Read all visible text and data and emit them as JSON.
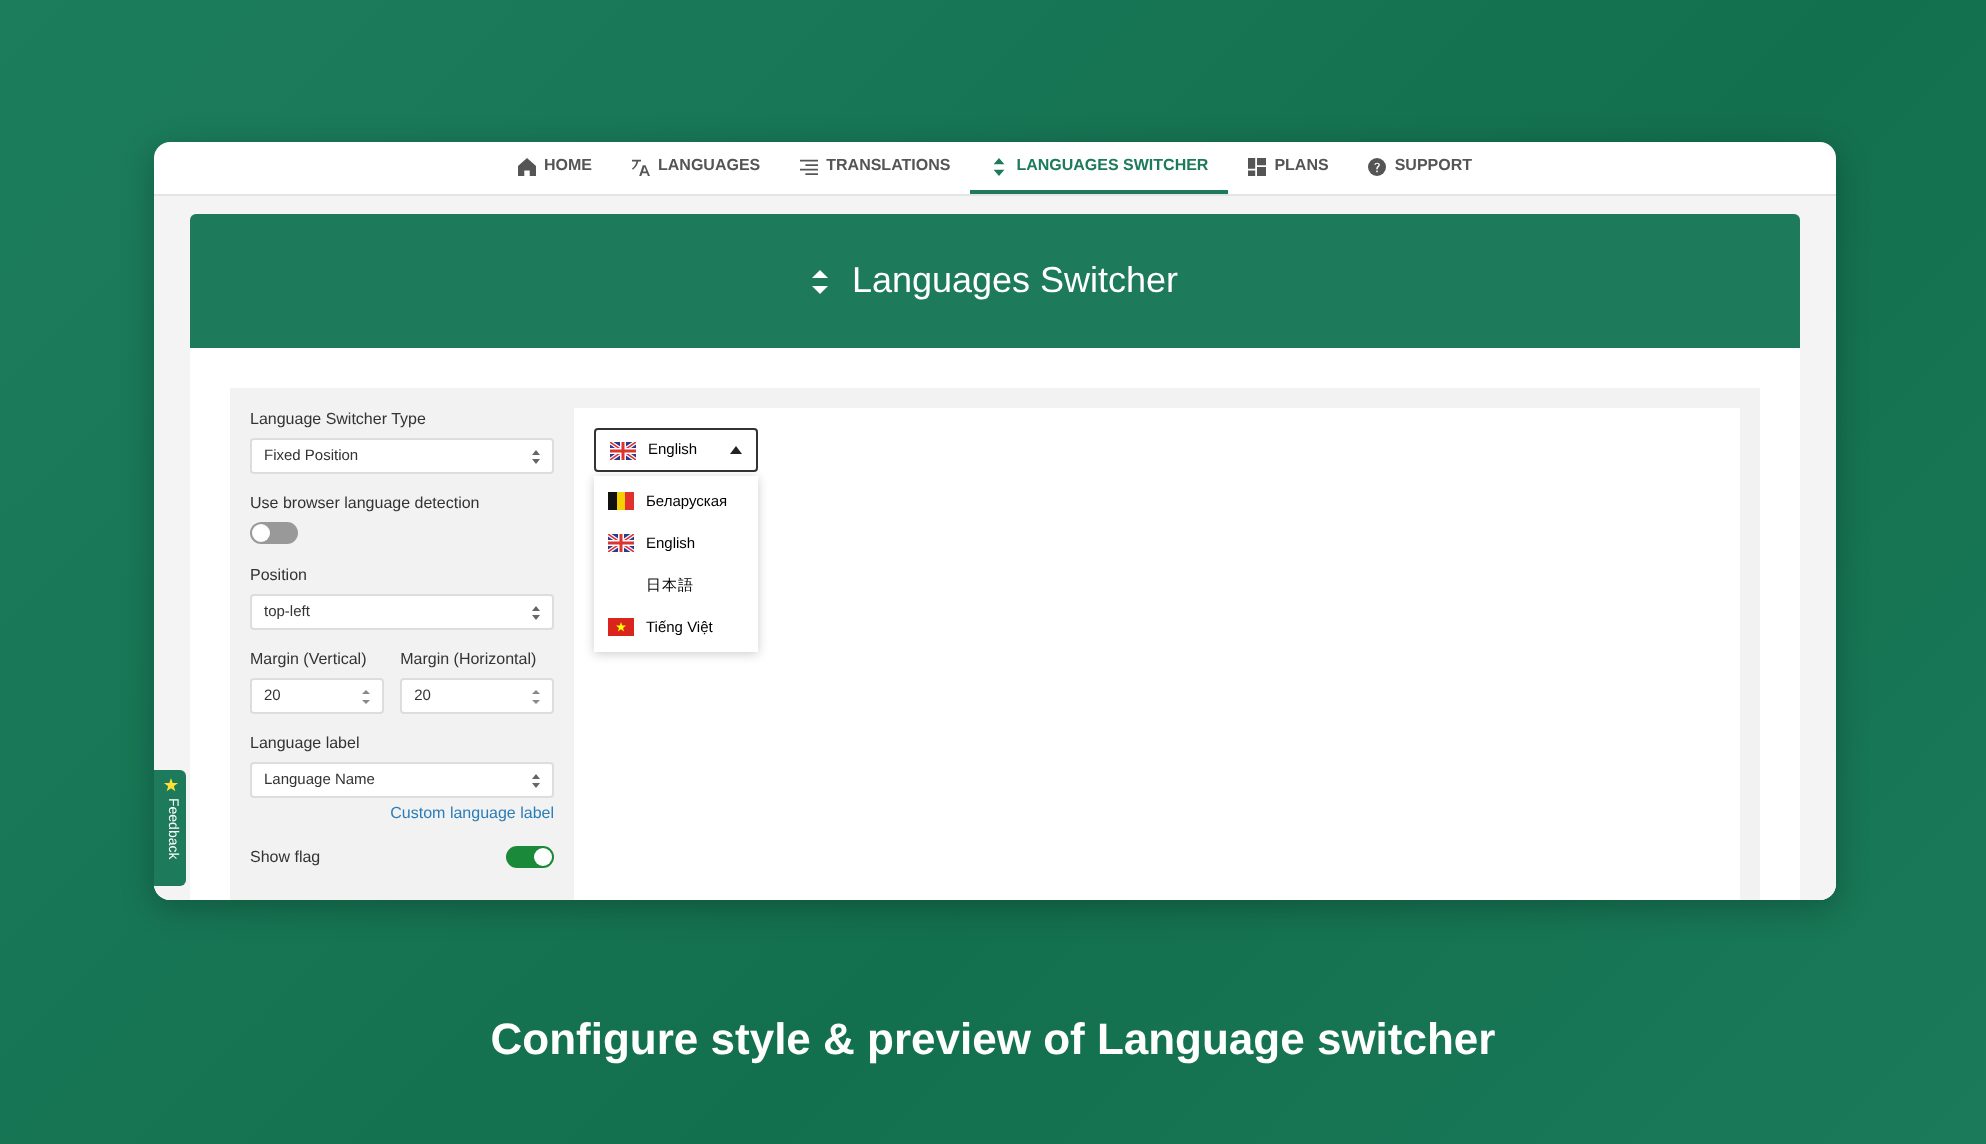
{
  "nav": [
    {
      "label": "HOME",
      "kind": "home",
      "selected": false
    },
    {
      "label": "LANGUAGES",
      "kind": "translate",
      "selected": false
    },
    {
      "label": "TRANSLATIONS",
      "kind": "lines",
      "selected": false
    },
    {
      "label": "LANGUAGES SWITCHER",
      "kind": "updown",
      "selected": true
    },
    {
      "label": "PLANS",
      "kind": "blocks",
      "selected": false
    },
    {
      "label": "SUPPORT",
      "kind": "question",
      "selected": false
    }
  ],
  "header": {
    "title": "Languages Switcher"
  },
  "form": {
    "switcher_type": {
      "label": "Language Switcher Type",
      "value": "Fixed Position"
    },
    "detection": {
      "label": "Use browser language detection",
      "checked": false
    },
    "position": {
      "label": "Position",
      "value": "top-left"
    },
    "margin_vertical": {
      "label": "Margin (Vertical)",
      "value": "20"
    },
    "margin_horizontal": {
      "label": "Margin (Horizontal)",
      "value": "20"
    },
    "language_label": {
      "label": "Language label",
      "value": "Language Name"
    },
    "custom_link": "Custom language label",
    "show_flag": {
      "label": "Show flag",
      "checked": true
    }
  },
  "preview": {
    "current": {
      "label": "English",
      "kind": "union"
    },
    "expanded": true,
    "options": [
      {
        "label": "Беларуская",
        "kind": "tricolor"
      },
      {
        "label": "English",
        "kind": "union"
      },
      {
        "label": "日本語",
        "kind": "none"
      },
      {
        "label": "Tiếng Việt",
        "kind": "star"
      }
    ]
  },
  "feedback": "Feedback",
  "caption": "Configure style & preview of Language switcher"
}
